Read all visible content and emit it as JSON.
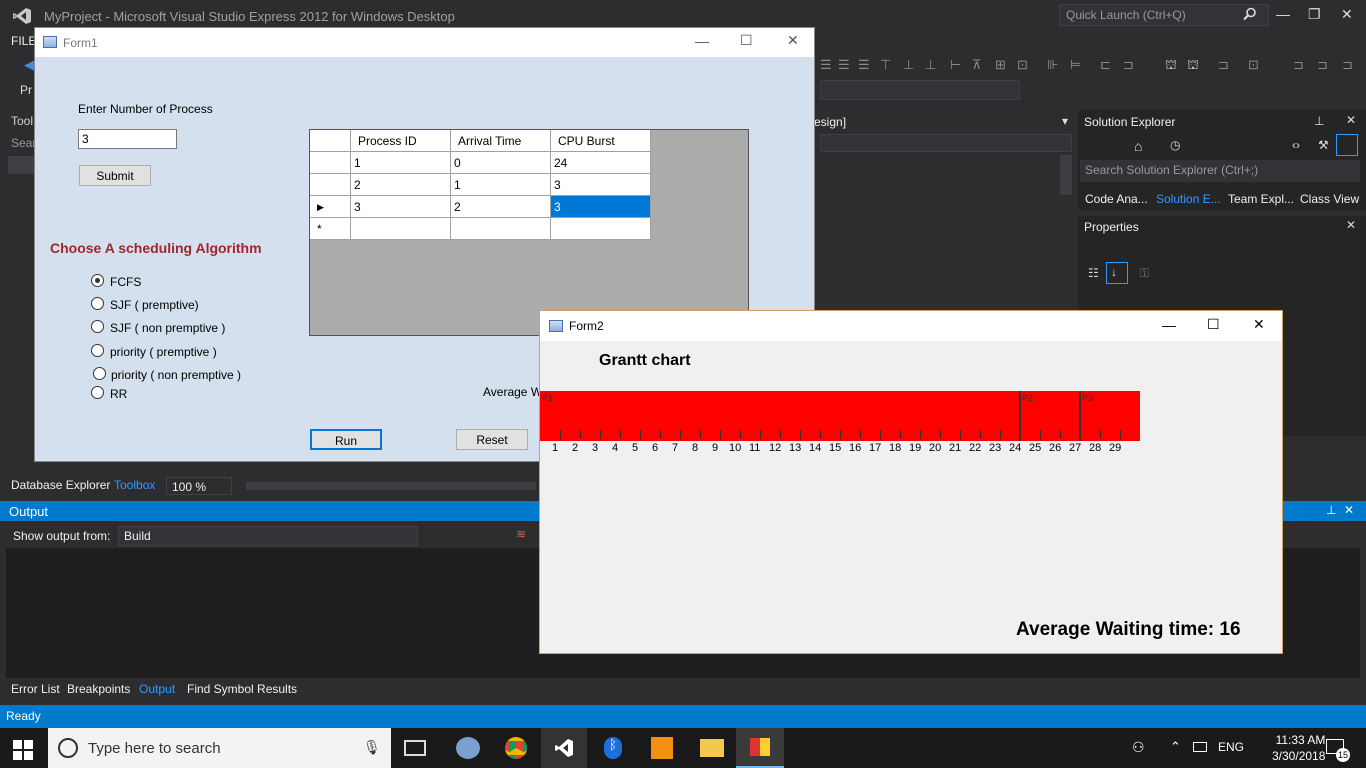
{
  "vs": {
    "title": "MyProject - Microsoft Visual Studio Express 2012 for Windows Desktop",
    "quick_launch": "Quick Launch (Ctrl+Q)",
    "menu_file": "FILE",
    "toolbox_tab": "Tool",
    "toolbox_search": "Sear",
    "design_tab": "esign]",
    "solution_explorer_title": "Solution Explorer",
    "solution_search": "Search Solution Explorer (Ctrl+;)",
    "solution_tabs": [
      "Code Ana...",
      "Solution E...",
      "Team Expl...",
      "Class View"
    ],
    "properties_title": "Properties",
    "bottom_tabs_top": [
      "Database Explorer",
      "Toolbox"
    ],
    "zoom": "100 %",
    "output_title": "Output",
    "output_from_label": "Show output from:",
    "output_from_value": "Build",
    "bottom_tabs": [
      "Error List",
      "Breakpoints",
      "Output",
      "Find Symbol Results"
    ],
    "status": "Ready"
  },
  "taskbar": {
    "search_placeholder": "Type here to search",
    "language": "ENG",
    "time": "11:33 AM",
    "date": "3/30/2018",
    "notifications": "15"
  },
  "form1": {
    "title": "Form1",
    "num_label": "Enter Number of Process",
    "num_value": "3",
    "submit": "Submit",
    "algo_title": "Choose A scheduling Algorithm",
    "algorithms": [
      {
        "label": "FCFS",
        "checked": true
      },
      {
        "label": "SJF ( premptive)",
        "checked": false
      },
      {
        "label": "SJF ( non premptive )",
        "checked": false
      },
      {
        "label": "priority ( premptive )",
        "checked": false
      },
      {
        "label": "priority ( non premptive )",
        "checked": false
      },
      {
        "label": "RR",
        "checked": false
      }
    ],
    "avg_label": "Average Wa",
    "run": "Run",
    "reset": "Reset",
    "grid": {
      "columns": [
        "Process ID",
        "Arrival Time",
        "CPU Burst"
      ],
      "rows": [
        [
          "1",
          "0",
          "24"
        ],
        [
          "2",
          "1",
          "3"
        ],
        [
          "3",
          "2",
          "3"
        ]
      ]
    }
  },
  "form2": {
    "title": "Form2",
    "gantt_title": "Grantt chart",
    "avg_wait": "Average Waiting time: 16",
    "gantt": {
      "segments": [
        {
          "label": "P1",
          "start": 0,
          "end": 24
        },
        {
          "label": "P2",
          "start": 24,
          "end": 27
        },
        {
          "label": "P3",
          "start": 27,
          "end": 30
        }
      ],
      "ticks": [
        "1",
        "2",
        "3",
        "4",
        "5",
        "6",
        "7",
        "8",
        "9",
        "10",
        "11",
        "12",
        "13",
        "14",
        "15",
        "16",
        "17",
        "18",
        "19",
        "20",
        "21",
        "22",
        "23",
        "24",
        "25",
        "26",
        "27",
        "28",
        "29"
      ],
      "total": 30,
      "color": "#ff0000"
    }
  }
}
